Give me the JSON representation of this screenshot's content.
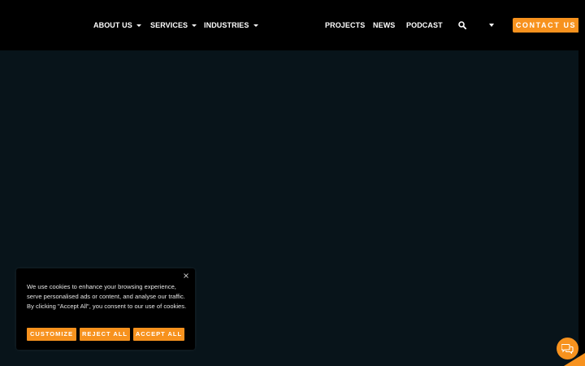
{
  "header": {
    "nav": [
      {
        "label": "ABOUT US"
      },
      {
        "label": "SERVICES"
      },
      {
        "label": "INDUSTRIES"
      },
      {
        "label": "PROJECTS"
      },
      {
        "label": "NEWS"
      },
      {
        "label": "PODCAST"
      }
    ],
    "contact_label": "CONTACT US",
    "icons": {
      "search": "search-icon",
      "language": "chevron-down-icon"
    }
  },
  "cookie": {
    "text": "We use cookies to enhance your browsing experience, serve personalised ads or content, and analyse our traffic. By clicking \"Accept All\", you consent to our use of cookies.",
    "buttons": {
      "customize": "CUSTOMIZE",
      "reject": "REJECT ALL",
      "accept": "ACCEPT ALL"
    }
  },
  "colors": {
    "accent": "#f7921e",
    "header_bg": "#000000",
    "page_bg": "#08141a"
  }
}
